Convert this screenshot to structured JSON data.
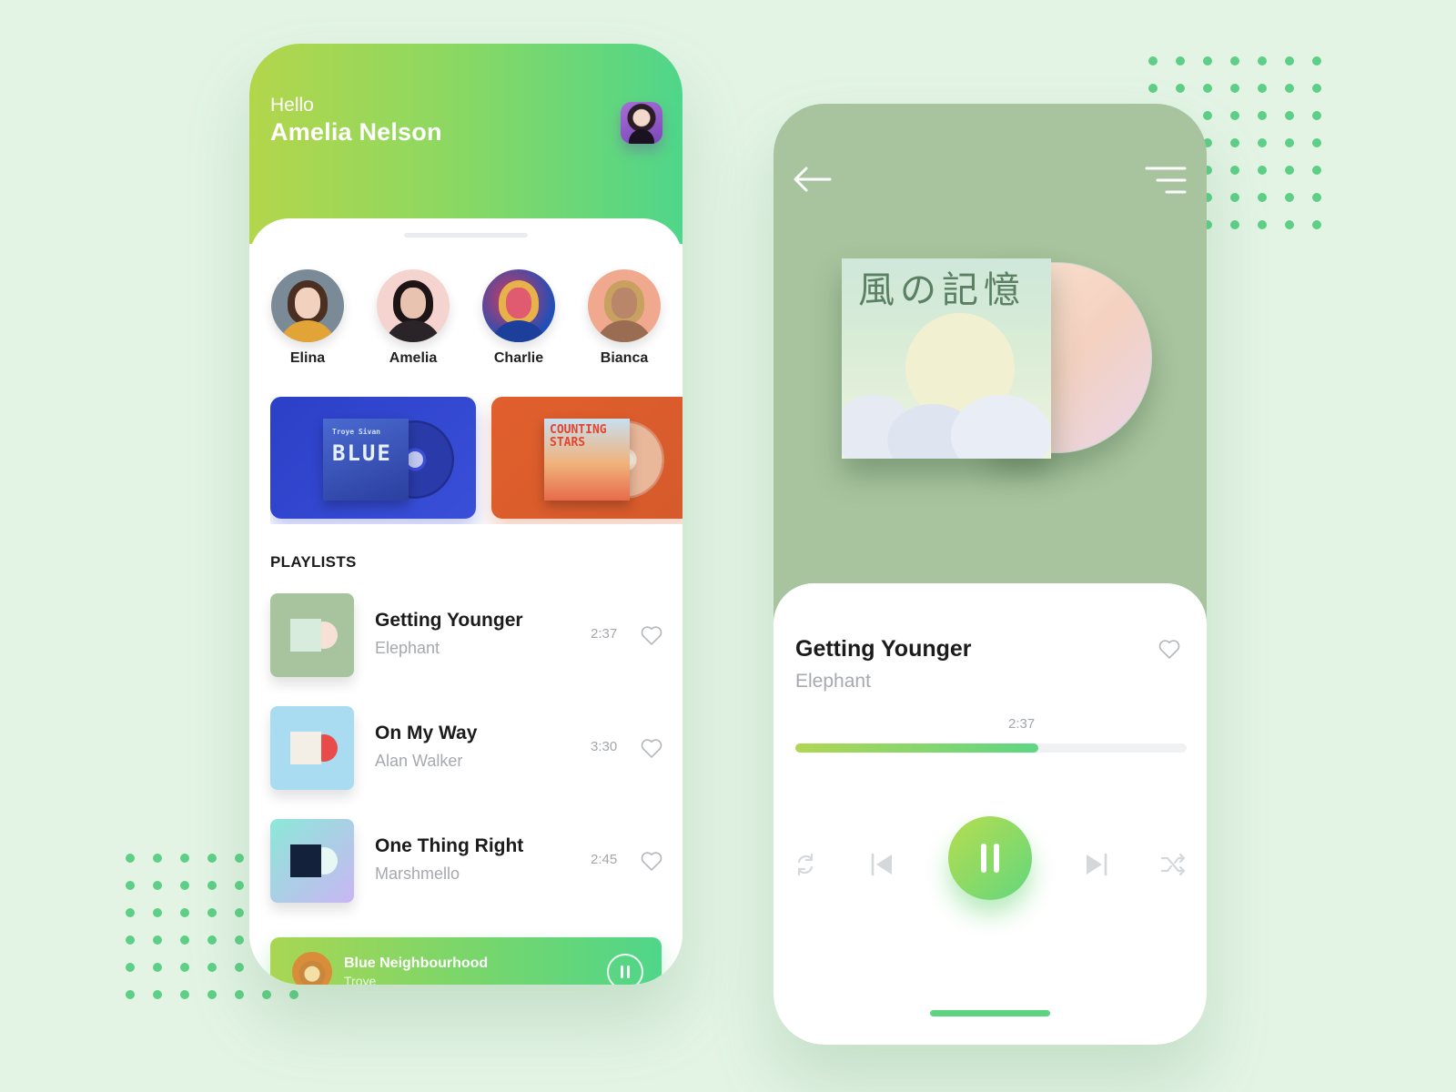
{
  "home": {
    "greeting": "Hello",
    "user_name": "Amelia Nelson",
    "artists": [
      {
        "name": "Elina"
      },
      {
        "name": "Amelia"
      },
      {
        "name": "Charlie"
      },
      {
        "name": "Bianca"
      }
    ],
    "featured_albums": [
      {
        "cover_text": "BLUE",
        "artist_text": "Troye Sivan"
      },
      {
        "cover_text": "COUNTING STARS",
        "artist_text": ""
      }
    ],
    "playlists_heading": "PLAYLISTS",
    "tracks": [
      {
        "title": "Getting Younger",
        "artist": "Elephant",
        "duration": "2:37"
      },
      {
        "title": "On My Way",
        "artist": "Alan Walker",
        "duration": "3:30"
      },
      {
        "title": "One Thing Right",
        "artist": "Marshmello",
        "duration": "2:45"
      }
    ],
    "mini_player": {
      "title": "Blue Neighbourhood",
      "artist": "Troye"
    }
  },
  "player": {
    "cover_title": "風の記憶",
    "title": "Getting Younger",
    "artist": "Elephant",
    "elapsed": "2:37",
    "progress": 0.62
  },
  "colors": {
    "background": "#e3f4e5",
    "accent_green": "#5dd684",
    "accent_lime": "#b1d653"
  },
  "icons": {
    "back": "arrow-left-icon",
    "menu": "menu-icon",
    "heart": "heart-icon",
    "repeat": "repeat-icon",
    "previous": "skip-previous-icon",
    "pause": "pause-icon",
    "next": "skip-next-icon",
    "shuffle": "shuffle-icon"
  }
}
